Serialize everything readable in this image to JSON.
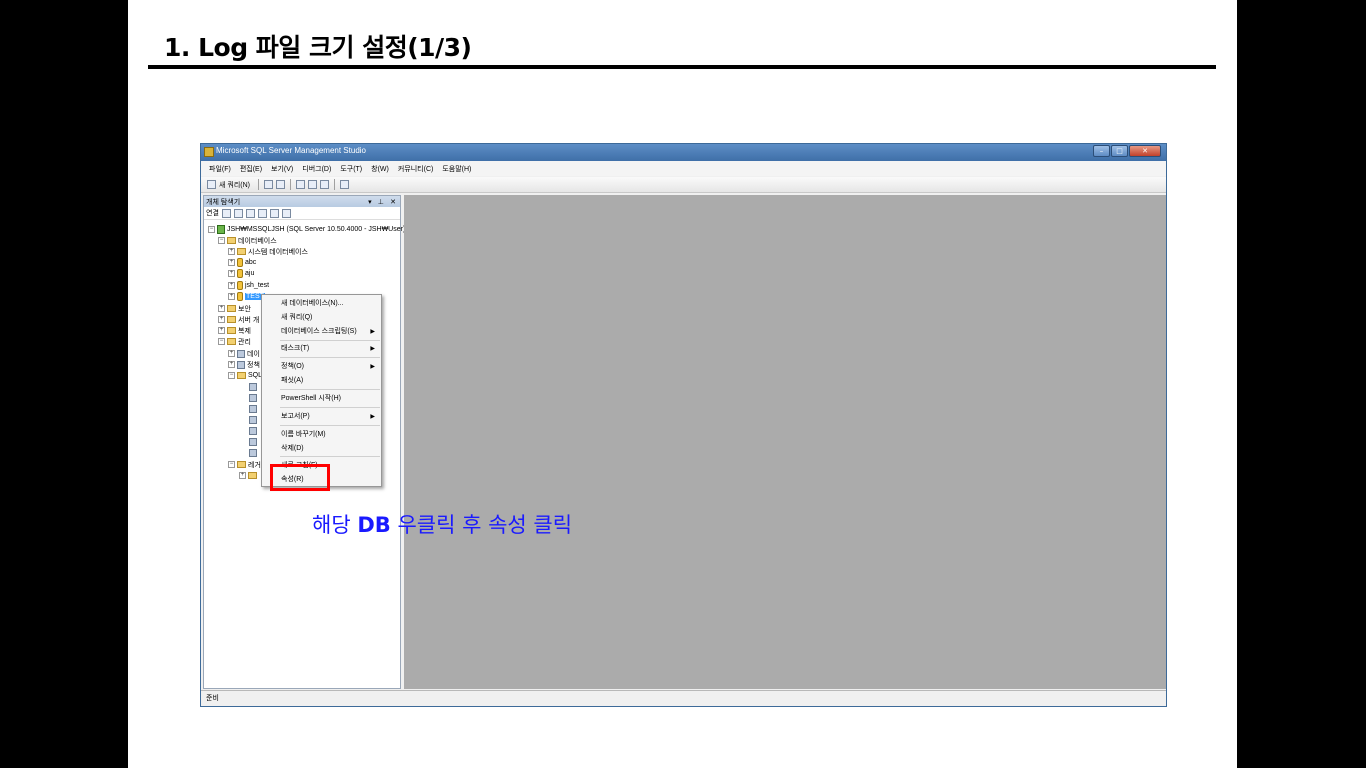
{
  "slide": {
    "title": "1. Log 파일 크기 설정(1/3)"
  },
  "window": {
    "title": "Microsoft SQL Server Management Studio",
    "menu": [
      "파일(F)",
      "편집(E)",
      "보기(V)",
      "디버그(D)",
      "도구(T)",
      "창(W)",
      "커뮤니티(C)",
      "도움말(H)"
    ],
    "toolbar": {
      "new_query": "새 쿼리(N)"
    },
    "status": "준비"
  },
  "object_explorer": {
    "title": "개체 탐색기",
    "connect": "연결",
    "tree": {
      "server": "JSH₩MSSQLJSH (SQL Server 10.50.4000 - JSH₩User)",
      "databases": "데이터베이스",
      "system_databases": "시스템 데이터베이스",
      "db_abc": "abc",
      "db_aju": "aju",
      "db_jsh_test": "jsh_test",
      "db_test": "TEST",
      "security": "보안",
      "server_objects": "서버 개",
      "replication": "복제",
      "management": "관리",
      "mgmt_data": "데이",
      "mgmt_policy": "정책",
      "mgmt_sql": "SQL",
      "legacy": "레거"
    }
  },
  "context_menu": {
    "items": [
      "새 데이터베이스(N)...",
      "새 쿼리(Q)",
      "데이터베이스 스크립팅(S)",
      "태스크(T)",
      "정책(O)",
      "패싯(A)",
      "PowerShell 시작(H)",
      "보고서(P)",
      "이름 바꾸기(M)",
      "삭제(D)",
      "새로 고침(F)",
      "속성(R)"
    ]
  },
  "annotation": {
    "part1": "해당 ",
    "part2": "DB",
    "part3": " 우클릭 후 속성 클릭"
  },
  "colors": {
    "annotation": "#1a1aff",
    "highlight": "#ff0000",
    "workspace": "#ababab",
    "selection": "#3399ff"
  }
}
